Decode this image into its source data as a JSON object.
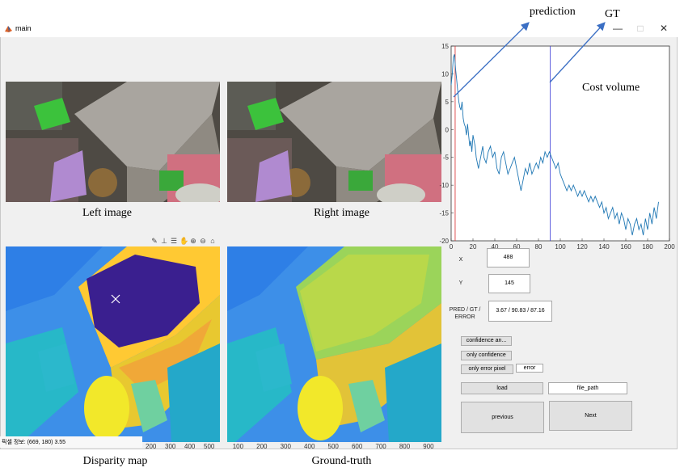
{
  "window": {
    "title": "main",
    "controls": {
      "minimize": "—",
      "maximize": "□",
      "close": "✕"
    }
  },
  "panels": {
    "left_caption": "Left image",
    "right_caption": "Right image",
    "disparity_caption": "Disparity map",
    "gt_caption": "Ground-truth"
  },
  "annotations": {
    "prediction": "prediction",
    "gt": "GT",
    "cost_volume": "Cost volume"
  },
  "status_bar": "픽셀 정보: (669, 180)  3.55",
  "disparity_axis_labels": [
    "200",
    "300",
    "400",
    "500"
  ],
  "gt_axis_labels": [
    "100",
    "200",
    "300",
    "400",
    "500",
    "600",
    "700",
    "800",
    "900"
  ],
  "controls": {
    "x_label": "X",
    "x_value": "488",
    "y_label": "Y",
    "y_value": "145",
    "pge_label": "PRED / GT / ERROR",
    "pge_value": "3.67 / 90.83 / 87.16",
    "confidence_button": "confidence an...",
    "only_confidence_button": "only confidence",
    "only_error_button": "only error pixel",
    "error_field": "error",
    "load_button": "load",
    "file_path_field": "file_path",
    "previous_button": "previous",
    "next_button": "Next"
  },
  "toolbar_icons": [
    "brush-icon",
    "data-cursor-icon",
    "legend-icon",
    "pan-icon",
    "zoom-in-icon",
    "zoom-out-icon",
    "home-icon"
  ],
  "colors": {
    "curve": "#1f77b4",
    "prediction_line": "#d62728",
    "gt_line": "#3a3ad6",
    "arrow": "#3b6fc4"
  },
  "chart_data": {
    "type": "line",
    "xlim": [
      0,
      200
    ],
    "ylim": [
      -20,
      15
    ],
    "xticks": [
      0,
      20,
      40,
      60,
      80,
      100,
      120,
      140,
      160,
      180,
      200
    ],
    "yticks": [
      15,
      10,
      5,
      0,
      -5,
      -10,
      -15,
      -20
    ],
    "prediction_x": 3.67,
    "gt_x": 90.83,
    "series": [
      {
        "x": [
          0,
          1,
          2,
          3,
          4,
          5,
          6,
          7,
          8,
          9,
          10,
          11,
          12,
          13,
          14,
          15,
          16,
          17,
          18,
          19,
          20,
          21,
          22,
          23,
          24,
          25,
          26,
          27,
          28,
          29,
          30,
          32,
          34,
          36,
          38,
          40,
          42,
          44,
          46,
          48,
          50,
          52,
          54,
          56,
          58,
          60,
          62,
          64,
          66,
          68,
          70,
          72,
          74,
          76,
          78,
          80,
          82,
          84,
          86,
          88,
          90,
          92,
          94,
          96,
          98,
          100,
          102,
          104,
          106,
          108,
          110,
          112,
          114,
          116,
          118,
          120,
          122,
          124,
          126,
          128,
          130,
          132,
          134,
          136,
          138,
          140,
          142,
          144,
          146,
          148,
          150,
          152,
          154,
          156,
          158,
          160,
          162,
          164,
          166,
          168,
          170,
          172,
          174,
          176,
          178,
          180,
          182,
          184,
          186,
          188,
          190
        ],
        "y": [
          8,
          10,
          13,
          13.5,
          11,
          9,
          7,
          5,
          4,
          3.5,
          5,
          2,
          1,
          0.5,
          -1,
          1,
          -1,
          -3,
          -2,
          -4,
          -1,
          -2,
          -3,
          -5,
          -6,
          -7,
          -6,
          -5,
          -4,
          -3,
          -5,
          -6,
          -4,
          -3,
          -5,
          -4,
          -7,
          -8,
          -5,
          -4,
          -6,
          -8,
          -7,
          -6,
          -5,
          -7,
          -9,
          -11,
          -9,
          -7,
          -8,
          -6,
          -8,
          -7,
          -6,
          -7,
          -5,
          -6,
          -4,
          -5,
          -4,
          -5,
          -6,
          -7,
          -6,
          -8,
          -9,
          -10,
          -11,
          -10,
          -11,
          -10,
          -11,
          -12,
          -11,
          -12,
          -11,
          -12,
          -13,
          -12,
          -13,
          -12,
          -13,
          -14,
          -13,
          -15,
          -14,
          -16,
          -15,
          -14,
          -16,
          -15,
          -17,
          -15,
          -16,
          -18,
          -16,
          -17,
          -19,
          -17,
          -16,
          -18,
          -17,
          -19,
          -16,
          -18,
          -15,
          -17,
          -14,
          -16,
          -13
        ]
      }
    ]
  }
}
